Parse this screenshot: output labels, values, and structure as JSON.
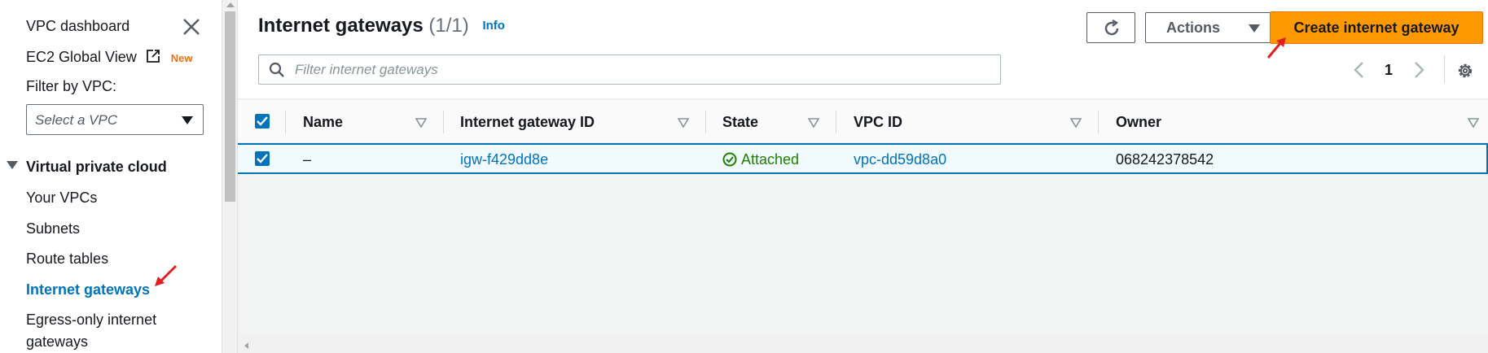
{
  "sidebar": {
    "dashboard": "VPC dashboard",
    "global_view": "EC2 Global View",
    "new_badge": "New",
    "filter_label": "Filter by VPC:",
    "filter_placeholder": "Select a VPC",
    "section": "Virtual private cloud",
    "items": [
      "Your VPCs",
      "Subnets",
      "Route tables",
      "Internet gateways",
      "Egress-only internet",
      "gateways"
    ]
  },
  "header": {
    "title": "Internet gateways",
    "count": "(1/1)",
    "info": "Info",
    "actions_label": "Actions",
    "create_label": "Create internet gateway"
  },
  "search": {
    "placeholder": "Filter internet gateways"
  },
  "pagination": {
    "page": "1"
  },
  "table": {
    "columns": [
      "Name",
      "Internet gateway ID",
      "State",
      "VPC ID",
      "Owner"
    ],
    "rows": [
      {
        "name": "–",
        "id": "igw-f429dd8e",
        "state": "Attached",
        "vpc": "vpc-dd59d8a0",
        "owner": "068242378542",
        "selected": true
      }
    ]
  },
  "colors": {
    "accent": "#0073bb",
    "primary": "#ff9900",
    "success": "#1d8102",
    "annotation": "#e02020"
  }
}
